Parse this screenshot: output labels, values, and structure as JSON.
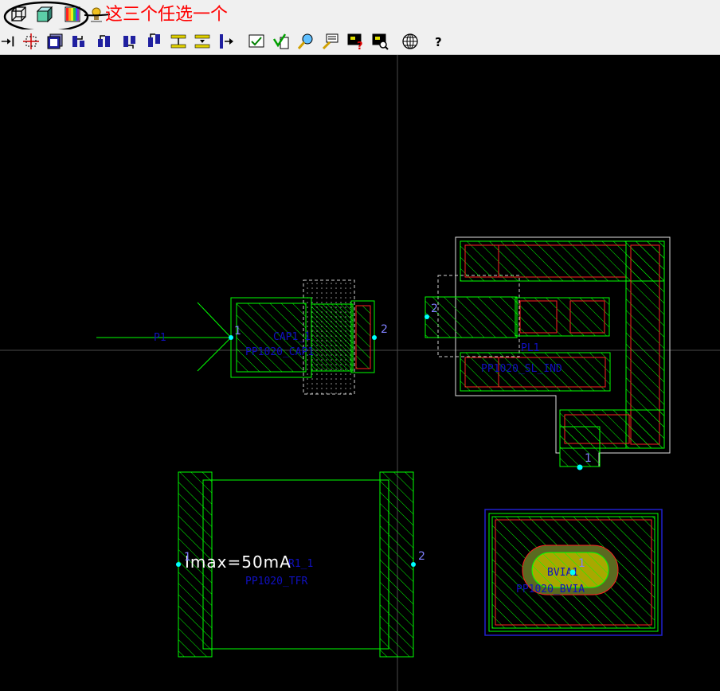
{
  "toolbar_top": {
    "annotation": "这三个任选一个",
    "buttons": [
      {
        "name": "wireframe-view-icon"
      },
      {
        "name": "solid-3d-view-icon"
      },
      {
        "name": "color-layer-view-icon"
      },
      {
        "name": "lamp-icon"
      }
    ]
  },
  "toolbar_second": {
    "buttons": [
      "pin-arrow-icon",
      "cross-grid-icon",
      "stack-view-icon",
      "layout-tool-a-icon",
      "layout-tool-b-icon",
      "layout-tool-c-icon",
      "layout-tool-d-icon",
      "align-center-icon",
      "align-center-alt-icon",
      "insert-arrow-icon",
      "edit-check-icon",
      "check-verify-icon",
      "magnify-search-icon",
      "highlight-icon",
      "question-board-icon",
      "zoom-board-icon",
      "globe-grid-icon",
      "help-icon"
    ],
    "help_glyph": "?"
  },
  "canvas": {
    "colors": {
      "background": "#000000",
      "trace": "#00ff00",
      "outline": "#ffffff",
      "red": "#ff2020",
      "blue": "#1010c0",
      "pin": "#00ffff"
    },
    "port": {
      "name": "P1"
    },
    "capacitor": {
      "name": "CAP1_1",
      "model": "PP1020_CAP1",
      "pin1": "1",
      "pin2": "2"
    },
    "inductor": {
      "name": "PL1",
      "model": "PP1020_SL_IND",
      "pin1": "1",
      "pin2": "2"
    },
    "resistor": {
      "name": "R1_1",
      "model": "PP1020_TFR",
      "pin1": "1",
      "pin2": "2",
      "imax": "Imax=50mA"
    },
    "via": {
      "name": "BVIA1",
      "model": "PP1020_BVIA",
      "pin1": "1"
    }
  }
}
